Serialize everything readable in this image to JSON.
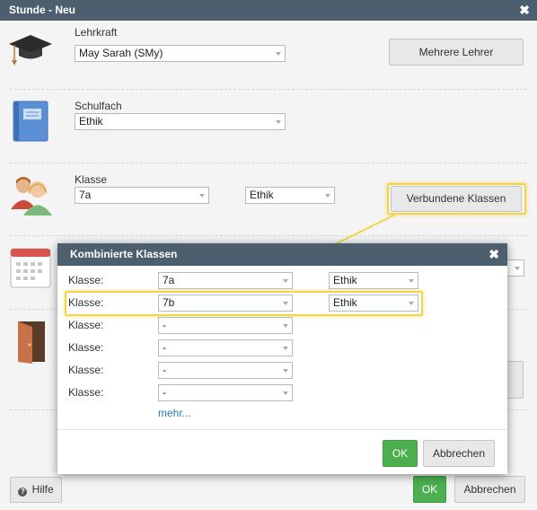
{
  "dialog": {
    "title": "Stunde - Neu",
    "close_glyph": "✖",
    "teacher": {
      "label": "Lehrkraft",
      "value": "May Sarah (SMy)",
      "multi_button": "Mehrere Lehrer"
    },
    "subject": {
      "label": "Schulfach",
      "value": "Ethik"
    },
    "class": {
      "label": "Klasse",
      "value": "7a",
      "subject_value": "Ethik",
      "linked_button": "Verbundene Klassen"
    },
    "help_button": "Hilfe",
    "help_icon_glyph": "?",
    "ok_button": "OK",
    "cancel_button": "Abbrechen",
    "icons": [
      "graduation-cap-icon",
      "book-icon",
      "people-icon",
      "calendar-icon",
      "door-icon"
    ]
  },
  "combined": {
    "title": "Kombinierte Klassen",
    "close_glyph": "✖",
    "rows": [
      {
        "label": "Klasse:",
        "class": "7a",
        "subject": "Ethik"
      },
      {
        "label": "Klasse:",
        "class": "7b",
        "subject": "Ethik"
      },
      {
        "label": "Klasse:",
        "class": "-"
      },
      {
        "label": "Klasse:",
        "class": "-"
      },
      {
        "label": "Klasse:",
        "class": "-"
      },
      {
        "label": "Klasse:",
        "class": "-"
      }
    ],
    "more_link": "mehr...",
    "ok_button": "OK",
    "cancel_button": "Abbrechen"
  },
  "colors": {
    "title_bar": "#4d5e6e",
    "ok_green": "#4caf50",
    "highlight": "#f3d54a",
    "link": "#2a7ab8"
  }
}
